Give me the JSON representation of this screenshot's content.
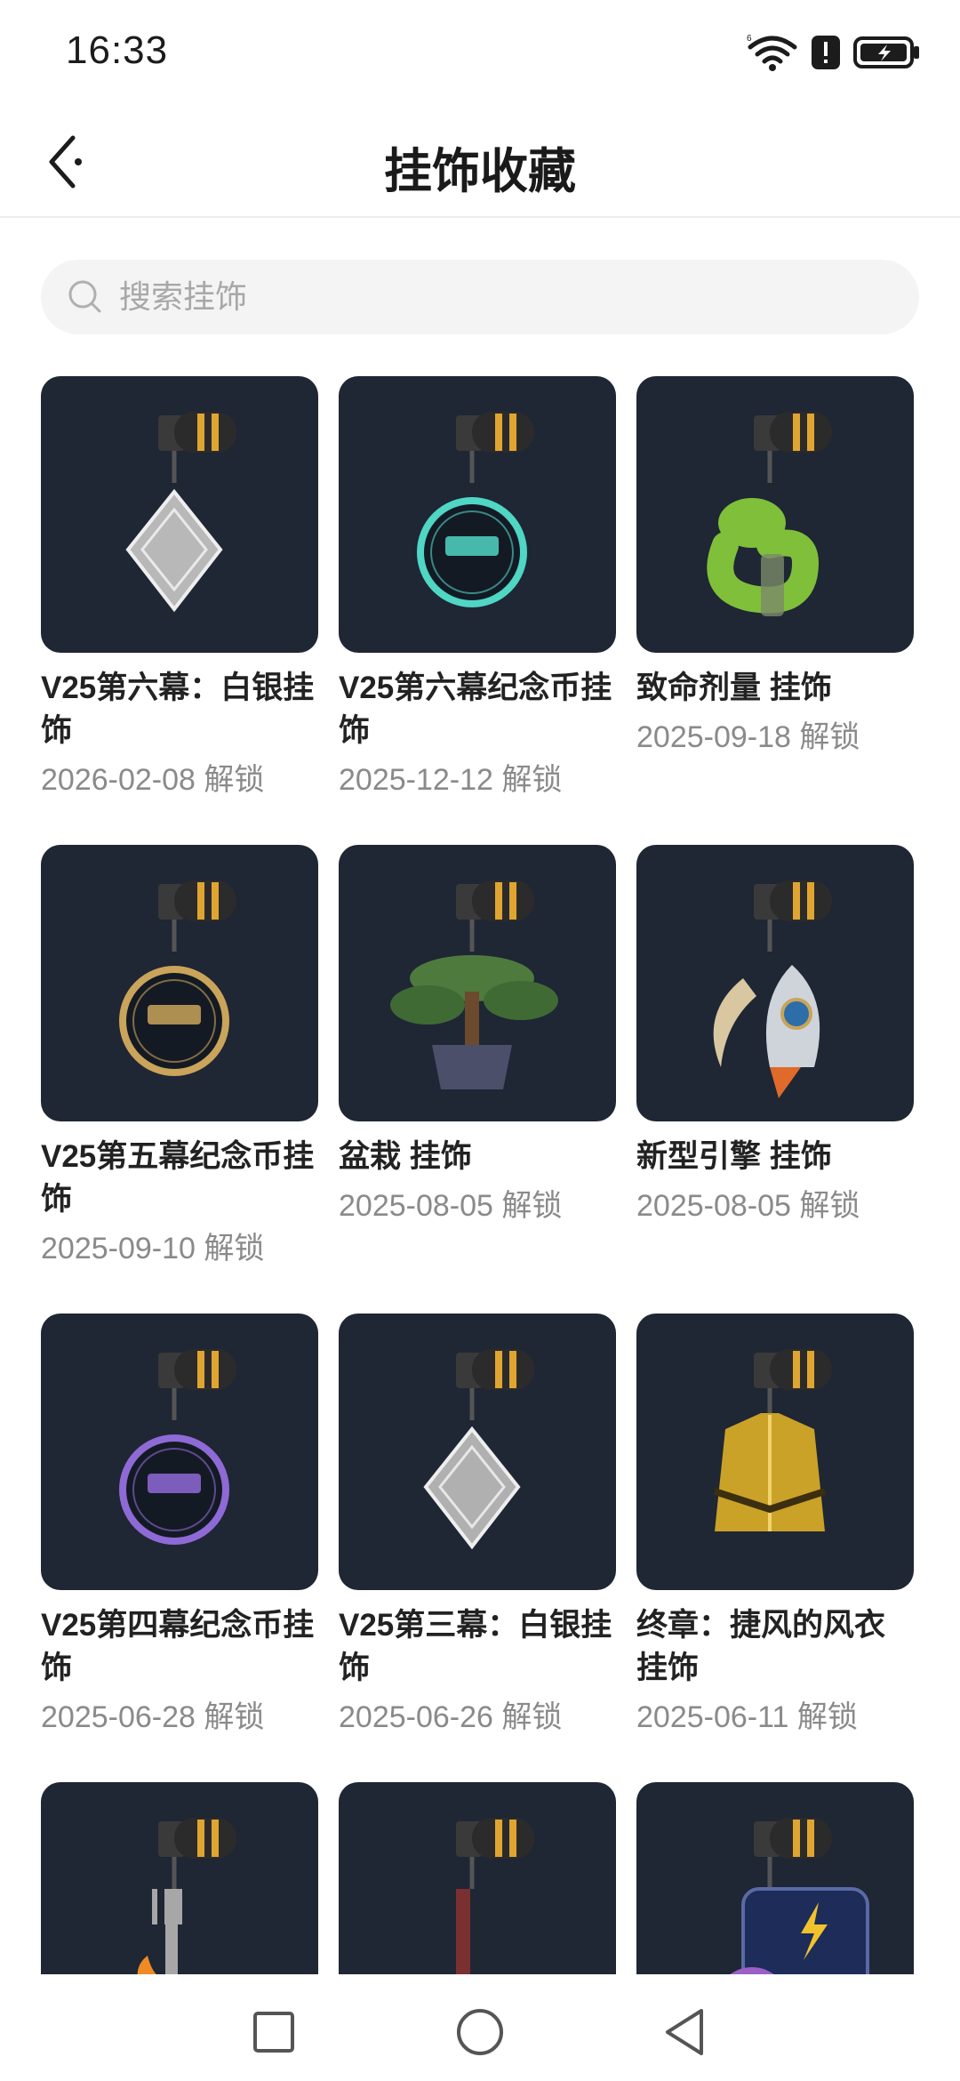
{
  "status_bar": {
    "time": "16:33",
    "icons": [
      "wifi-icon",
      "alert-icon",
      "battery-charging-icon"
    ]
  },
  "header": {
    "title": "挂饰收藏",
    "back_icon": "back-arrow-icon"
  },
  "search": {
    "placeholder": "搜索挂饰",
    "icon": "search-icon"
  },
  "items": [
    {
      "name": "V25第六幕：白银挂饰",
      "date": "2026-02-08 解锁",
      "art": "silver-diamond-charm",
      "color": "#b8b8b8"
    },
    {
      "name": "V25第六幕纪念币挂饰",
      "date": "2025-12-12 解锁",
      "art": "coin-vi-charm",
      "color": "#4fd6c4"
    },
    {
      "name": "致命剂量 挂饰",
      "date": "2025-09-18 解锁",
      "art": "green-snake-charm",
      "color": "#7fbf3a"
    },
    {
      "name": "V25第五幕纪念币挂饰",
      "date": "2025-09-10 解锁",
      "art": "coin-v-charm",
      "color": "#c9a45a"
    },
    {
      "name": "盆栽 挂饰",
      "date": "2025-08-05 解锁",
      "art": "bonsai-charm",
      "color": "#4e7a3e"
    },
    {
      "name": "新型引擎 挂饰",
      "date": "2025-08-05 解锁",
      "art": "rocket-charm",
      "color": "#cfd3da"
    },
    {
      "name": "V25第四幕纪念币挂饰",
      "date": "2025-06-28 解锁",
      "art": "coin-iv-charm",
      "color": "#8e6ad6"
    },
    {
      "name": "V25第三幕：白银挂饰",
      "date": "2025-06-26 解锁",
      "art": "silver-diamond-charm",
      "color": "#b0b0b0"
    },
    {
      "name": "终章：捷风的风衣挂饰",
      "date": "2025-06-11 解锁",
      "art": "gold-jacket-charm",
      "color": "#c9a227"
    },
    {
      "name": "",
      "date": "",
      "art": "fork-flame-charm",
      "color": "#b0453a"
    },
    {
      "name": "",
      "date": "",
      "art": "backpack-charm",
      "color": "#7a2f30"
    },
    {
      "name": "",
      "date": "",
      "art": "octopus-badge-charm",
      "color": "#9b5fc7"
    }
  ],
  "nav_bar": {
    "buttons": [
      "recents-square-icon",
      "home-circle-icon",
      "back-triangle-icon"
    ]
  }
}
